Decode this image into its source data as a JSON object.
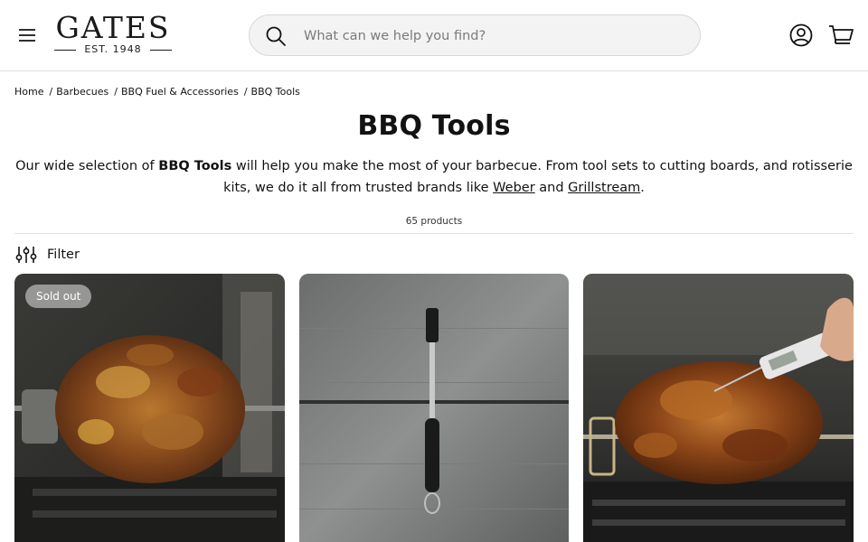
{
  "header": {
    "logo_main": "GATES",
    "logo_sub": "EST. 1948",
    "search_placeholder": "What can we help you find?"
  },
  "icons": [
    "menu-icon",
    "search-icon",
    "account-icon",
    "cart-icon",
    "filter-icon"
  ],
  "breadcrumb": [
    {
      "label": "Home"
    },
    {
      "label": "Barbecues"
    },
    {
      "label": "BBQ Fuel & Accessories"
    },
    {
      "label": "BBQ Tools"
    }
  ],
  "page": {
    "title": "BBQ Tools",
    "desc_part1": "Our wide selection of ",
    "desc_bold": "BBQ Tools",
    "desc_part2": " will help you make the most of your barbecue. From tool sets to cutting boards, and rotisserie kits, we do it all from trusted brands like ",
    "desc_link1": "Weber",
    "desc_part3": " and ",
    "desc_link2": "Grillstream",
    "desc_part4": ".",
    "product_count": "65 products",
    "filter_label": "Filter"
  },
  "products": [
    {
      "badge": "Sold out",
      "image": "rotisserie-kebab-photo"
    },
    {
      "image": "basting-brush-photo"
    },
    {
      "image": "rotisserie-chicken-thermometer-photo"
    }
  ],
  "colors": {
    "text": "#121212",
    "border": "#e2e2e2",
    "search_bg": "#f3f3f3"
  }
}
